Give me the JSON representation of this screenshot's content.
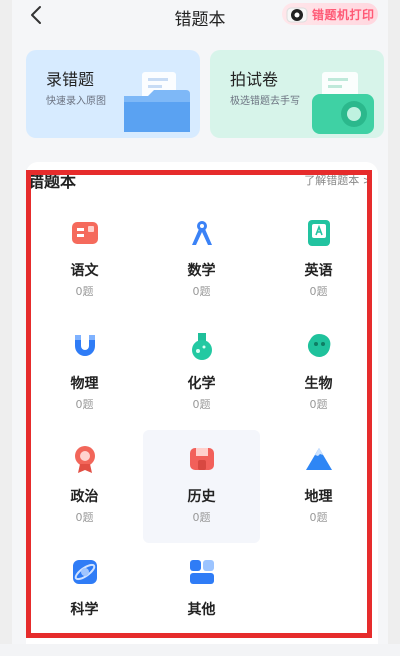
{
  "header": {
    "title": "错题本",
    "print_label": "错题机打印"
  },
  "cards": [
    {
      "title": "录错题",
      "subtitle": "快速录入原图",
      "color": "#d7ebff"
    },
    {
      "title": "拍试卷",
      "subtitle": "极选错题去手写",
      "color": "#d7f4ea"
    }
  ],
  "section": {
    "title": "错题本",
    "link": "了解错题本 >"
  },
  "subjects": [
    {
      "name": "语文",
      "count": "0题",
      "icon": "chinese-book-icon"
    },
    {
      "name": "数学",
      "count": "0题",
      "icon": "compass-icon"
    },
    {
      "name": "英语",
      "count": "0题",
      "icon": "english-book-icon"
    },
    {
      "name": "物理",
      "count": "0题",
      "icon": "magnet-icon"
    },
    {
      "name": "化学",
      "count": "0题",
      "icon": "flask-icon"
    },
    {
      "name": "生物",
      "count": "0题",
      "icon": "cell-icon"
    },
    {
      "name": "政治",
      "count": "0题",
      "icon": "medal-icon"
    },
    {
      "name": "历史",
      "count": "0题",
      "icon": "scroll-icon"
    },
    {
      "name": "地理",
      "count": "0题",
      "icon": "mountain-icon"
    },
    {
      "name": "科学",
      "count": "",
      "icon": "planet-icon"
    },
    {
      "name": "其他",
      "count": "",
      "icon": "grid-icon"
    }
  ]
}
